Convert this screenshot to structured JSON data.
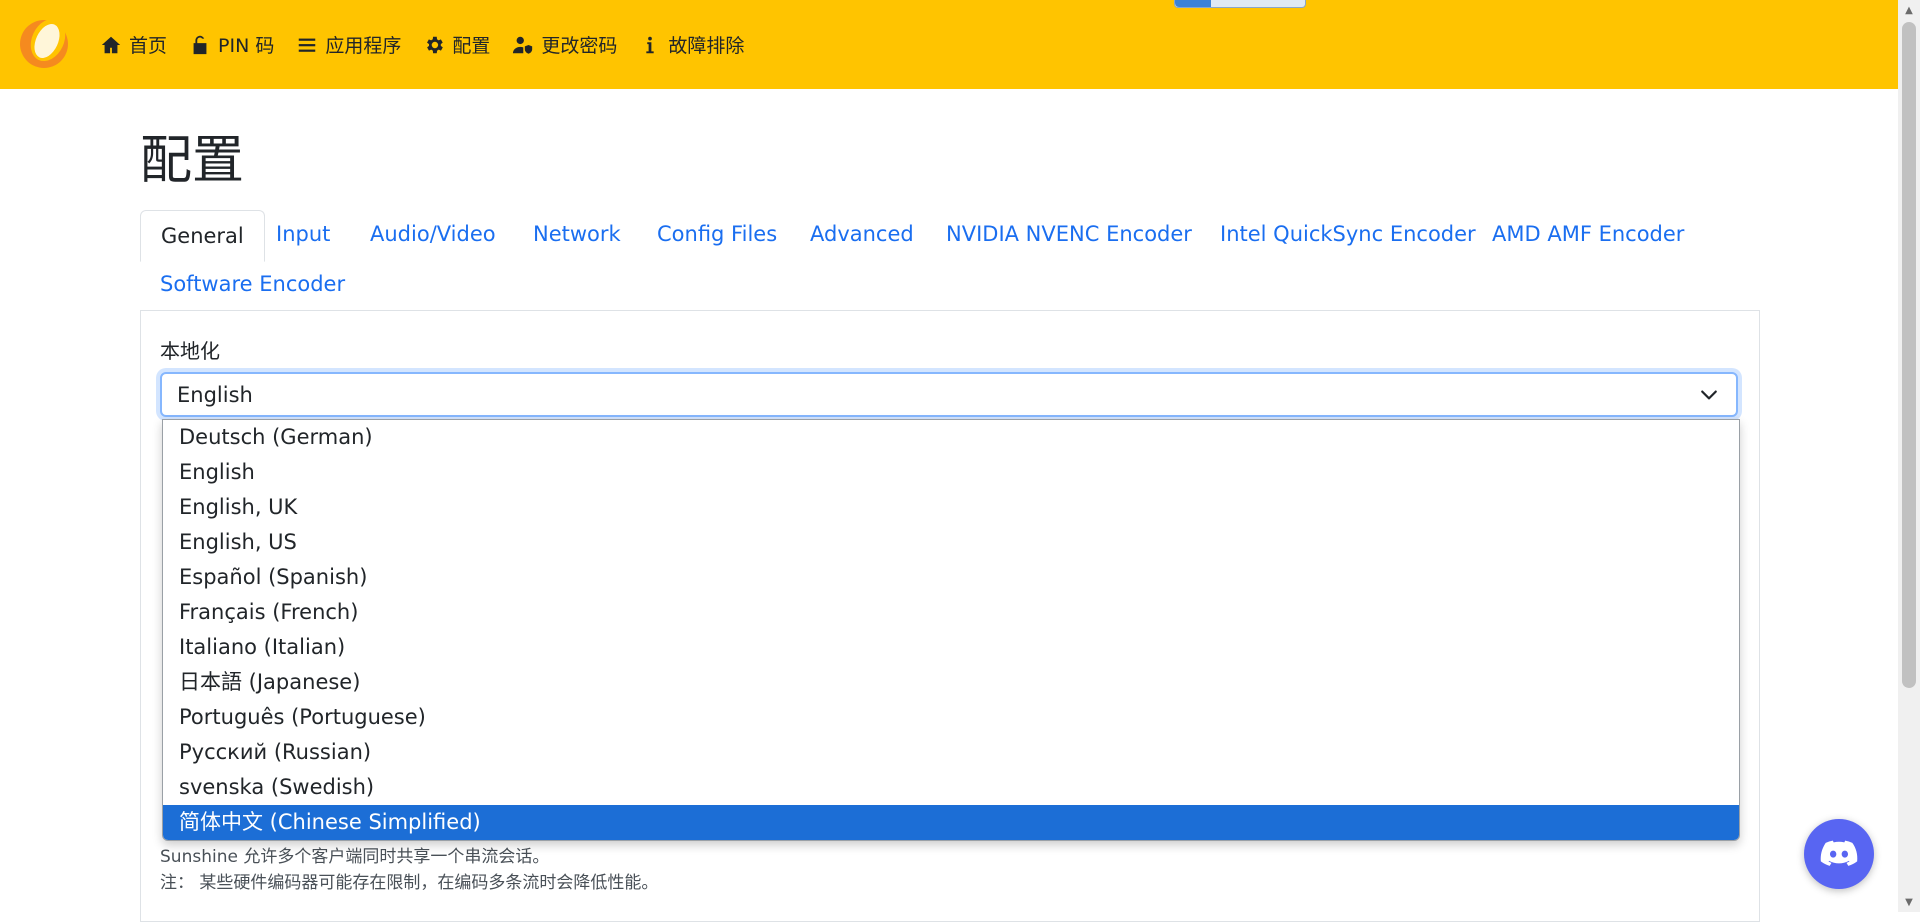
{
  "navbar": {
    "items": [
      {
        "label": "首页",
        "icon": "home-icon"
      },
      {
        "label": "PIN 码",
        "icon": "unlock-icon"
      },
      {
        "label": "应用程序",
        "icon": "list-icon"
      },
      {
        "label": "配置",
        "icon": "gear-icon"
      },
      {
        "label": "更改密码",
        "icon": "user-shield-icon"
      },
      {
        "label": "故障排除",
        "icon": "info-icon"
      }
    ],
    "background": "#ffc400"
  },
  "page": {
    "title": "配置"
  },
  "tabs": [
    {
      "label": "General",
      "active": true
    },
    {
      "label": "Input"
    },
    {
      "label": "Audio/Video"
    },
    {
      "label": "Network"
    },
    {
      "label": "Config Files"
    },
    {
      "label": "Advanced"
    },
    {
      "label": "NVIDIA NVENC Encoder"
    },
    {
      "label": "Intel QuickSync Encoder"
    },
    {
      "label": "AMD AMF Encoder"
    },
    {
      "label": "Software Encoder"
    }
  ],
  "general": {
    "locale_label": "本地化",
    "locale_value": "English",
    "locale_options": [
      "Deutsch (German)",
      "English",
      "English, UK",
      "English, US",
      "Español (Spanish)",
      "Français (French)",
      "Italiano (Italian)",
      "日本語 (Japanese)",
      "Português (Portuguese)",
      "Русский (Russian)",
      "svenska (Swedish)",
      "简体中文 (Chinese Simplified)"
    ],
    "highlighted_option": "简体中文 (Chinese Simplified)",
    "help_line1": "Sunshine 允许多个客户端同时共享一个串流会话。",
    "help_line2": "注： 某些硬件编码器可能存在限制，在编码多条流时会降低性能。"
  },
  "colors": {
    "accent": "#1a6ef0",
    "highlight": "#1c6ed6",
    "discord": "#5865f2"
  }
}
